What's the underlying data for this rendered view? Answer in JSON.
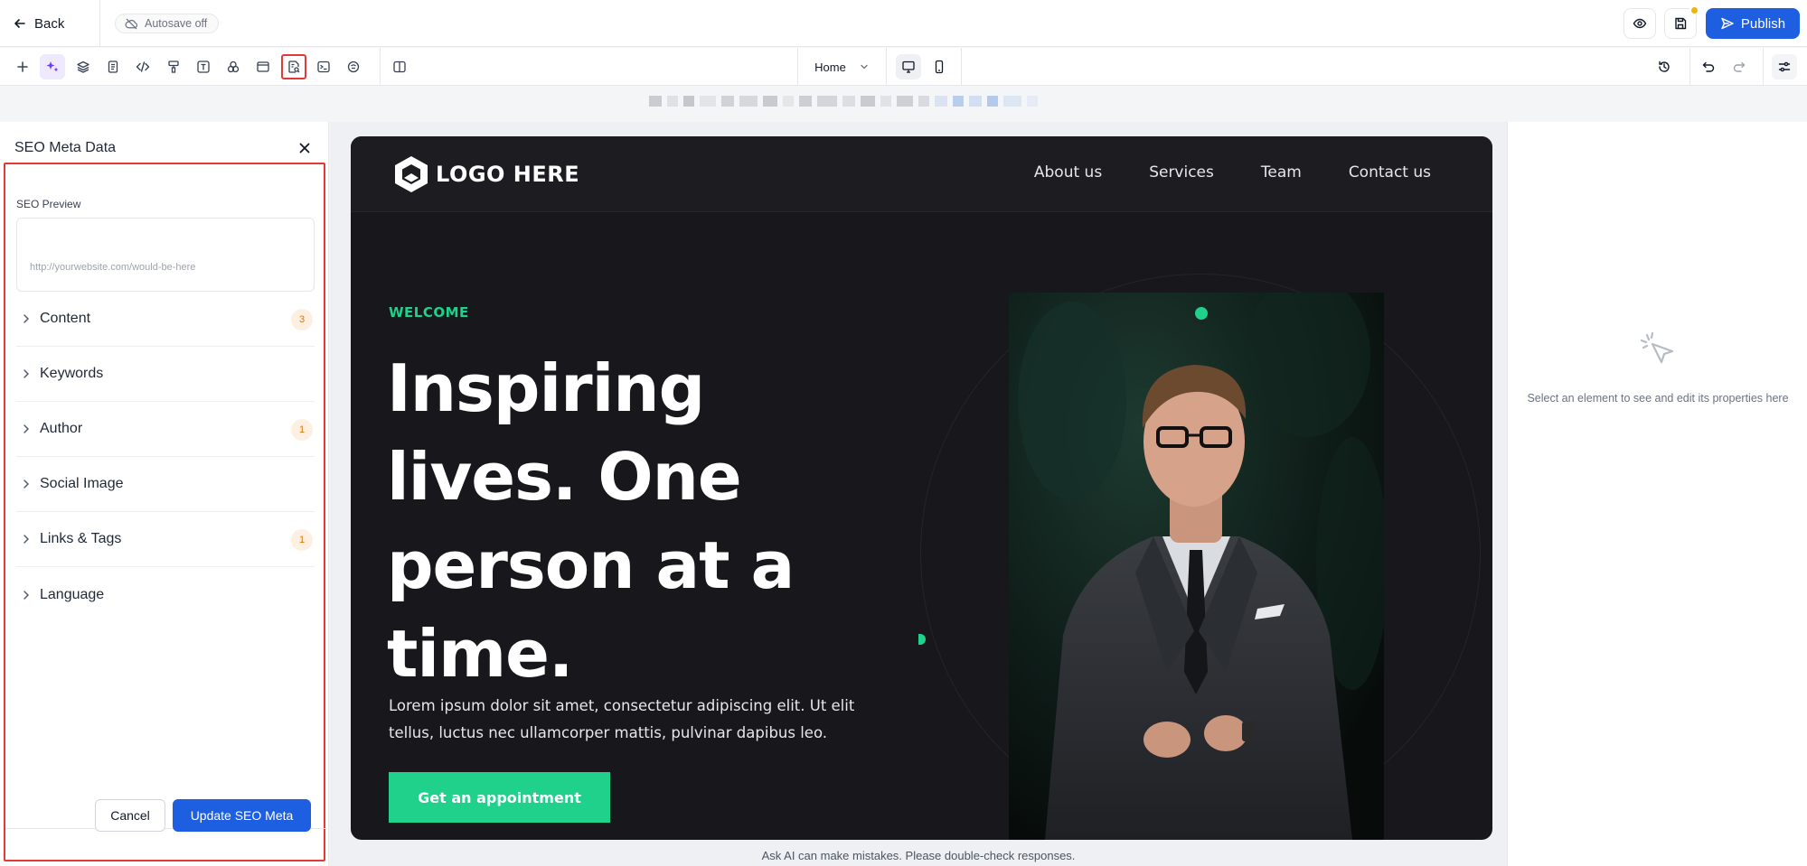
{
  "topbar": {
    "back_label": "Back",
    "autosave_label": "Autosave off",
    "publish_label": "Publish"
  },
  "toolbar": {
    "page_selected": "Home",
    "icons": [
      "add-icon",
      "ai-sparkle-icon",
      "layers-icon",
      "pages-icon",
      "code-icon",
      "paint-roller-icon",
      "text-icon",
      "components-icon",
      "window-icon",
      "seo-meta-icon",
      "terminal-icon",
      "integrations-icon",
      "split-view-icon"
    ]
  },
  "seo_panel": {
    "title": "SEO Meta Data",
    "preview_label": "SEO Preview",
    "preview_url": "http://yourwebsite.com/would-be-here",
    "sections": [
      {
        "label": "Content",
        "badge": "3"
      },
      {
        "label": "Keywords",
        "badge": ""
      },
      {
        "label": "Author",
        "badge": "1"
      },
      {
        "label": "Social Image",
        "badge": ""
      },
      {
        "label": "Links & Tags",
        "badge": "1"
      },
      {
        "label": "Language",
        "badge": ""
      }
    ],
    "cancel_label": "Cancel",
    "update_label": "Update SEO Meta"
  },
  "site": {
    "logo_text": "LOGO HERE",
    "nav": [
      "About us",
      "Services",
      "Team",
      "Contact us"
    ],
    "welcome": "WELCOME",
    "hero_title": "Inspiring lives. One person at a time.",
    "hero_body": "Lorem ipsum dolor sit amet, consectetur adipiscing elit. Ut elit tellus, luctus nec ullamcorper mattis, pulvinar dapibus leo.",
    "cta_label": "Get an appointment"
  },
  "properties_panel": {
    "empty_text": "Select an element to see and edit its properties here"
  },
  "disclaimer": "Ask AI can make mistakes. Please double-check responses.",
  "colors": {
    "brand_blue": "#1d5fe0",
    "accent_green": "#1fd18a",
    "ai_purple": "#6d3df0",
    "highlight_red": "#e53935",
    "badge_orange": "#d97706"
  }
}
